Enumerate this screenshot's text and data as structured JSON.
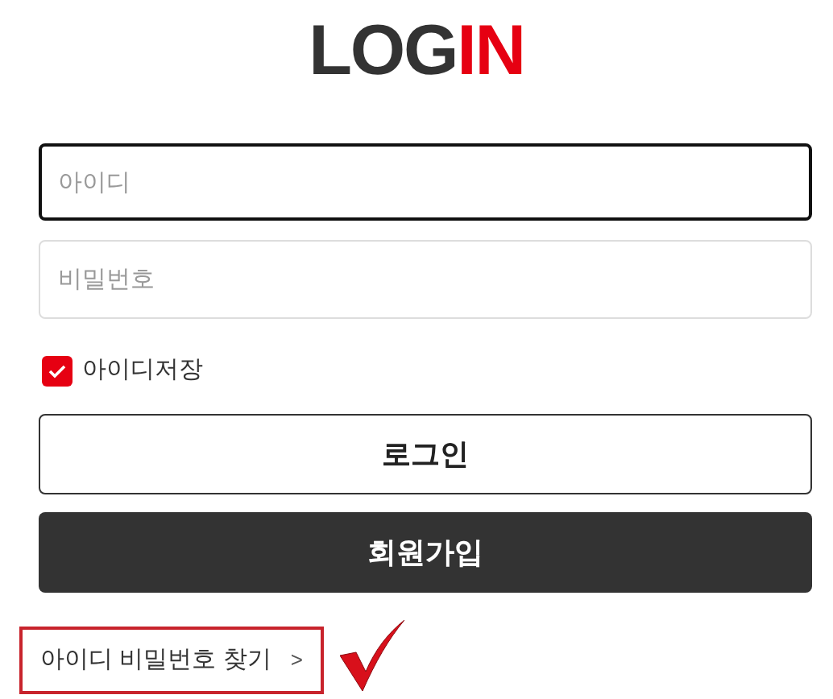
{
  "logo": {
    "parts": [
      {
        "text": "LOG",
        "color": "#333333"
      },
      {
        "text": "IN",
        "color": "#e60012"
      }
    ]
  },
  "fields": [
    {
      "placeholder": "아이디",
      "focused": true
    },
    {
      "placeholder": "비밀번호",
      "focused": false
    }
  ],
  "remember": {
    "label": "아이디저장",
    "checked": true
  },
  "buttons": [
    {
      "label": "로그인",
      "kind": "outline"
    },
    {
      "label": "회원가입",
      "kind": "filled"
    }
  ],
  "find_link": {
    "label": "아이디 비밀번호 찾기",
    "arrow": ">"
  }
}
